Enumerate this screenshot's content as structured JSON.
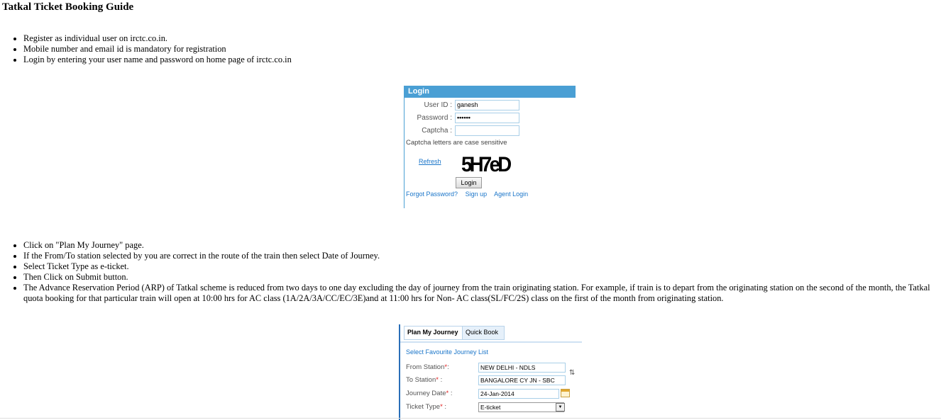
{
  "page": {
    "title": "Tatkal Ticket Booking Guide",
    "steps_part1": [
      "Register as individual user on irctc.co.in.",
      "Mobile number and email id is mandatory for registration",
      "Login by entering your user name and password on home page of irctc.co.in"
    ],
    "steps_part2": [
      "Click on \"Plan My Journey\" page.",
      "If the From/To station selected by you are correct in the route of the train then select Date of Journey.",
      "Select Ticket Type as e-ticket.",
      "Then Click on Submit button.",
      "The Advance Reservation Period (ARP) of Tatkal scheme is reduced from two days to one day excluding the day of journey from the train originating station. For example, if train is to depart from the originating station on the second of the month, the Tatkal quota booking for that particular train will open at 10:00 hrs for AC class (1A/2A/3A/CC/EC/3E)and at 11:00 hrs for Non- AC class(SL/FC/2S) class on the first of the month from originating station."
    ]
  },
  "login": {
    "header": "Login",
    "user_id_label": "User ID :",
    "user_id_value": "ganesh",
    "password_label": "Password :",
    "password_value": "••••••",
    "captcha_label": "Captcha :",
    "captcha_value": "",
    "case_note": "Captcha letters are case sensitive",
    "refresh_label": "Refresh",
    "captcha_text": "5H7eD",
    "login_button": "Login",
    "forgot_password": "Forgot Password?",
    "sign_up": "Sign up",
    "agent_login": "Agent Login"
  },
  "journey": {
    "tab_plan": "Plan My Journey",
    "tab_quick": "Quick Book",
    "favourite_link": "Select Favourite Journey List",
    "from_label": "From Station",
    "from_value": "NEW DELHI - NDLS",
    "to_label": "To Station",
    "to_value": "BANGALORE CY JN - SBC",
    "date_label": "Journey Date",
    "date_value": "24-Jan-2014",
    "ticket_type_label": "Ticket Type",
    "ticket_type_value": "E-ticket",
    "required_mark": "*",
    "colon": ":"
  },
  "icons": {
    "swap": "swap-arrows-icon",
    "calendar": "calendar-icon",
    "dropdown": "chevron-down-icon"
  },
  "colors": {
    "accent_blue": "#4a9fd4",
    "link_blue": "#1a75c9",
    "required_red": "#e02020"
  }
}
